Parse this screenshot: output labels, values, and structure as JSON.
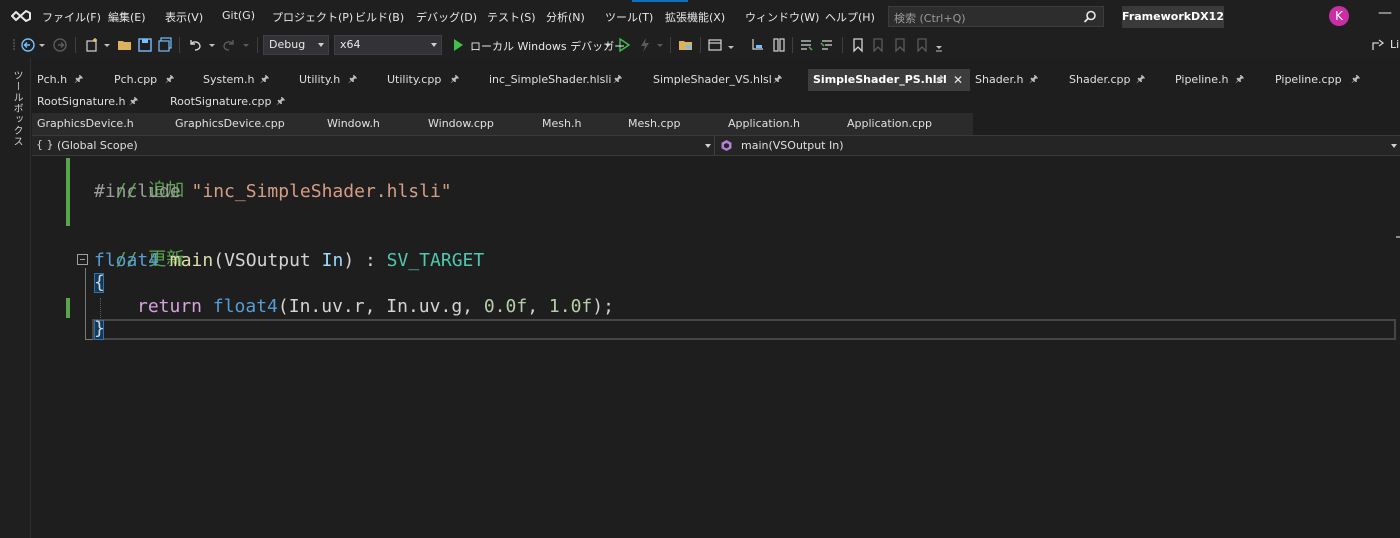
{
  "menu": [
    "ファイル(F)",
    "編集(E)",
    "表示(V)",
    "Git(G)",
    "プロジェクト(P)",
    "ビルド(B)",
    "デバッグ(D)",
    "テスト(S)",
    "分析(N)",
    "ツール(T)",
    "拡張機能(X)",
    "ウィンドウ(W)",
    "ヘルプ(H)"
  ],
  "search": {
    "placeholder": "検索 (Ctrl+Q)"
  },
  "project_name": "FrameworkDX12",
  "user_initial": "K",
  "window_controls": {
    "minimize": "—"
  },
  "toolbar": {
    "configuration": "Debug",
    "platform": "x64",
    "debugger_label": "ローカル Windows デバッガー",
    "live_share": "Li"
  },
  "toolbox_label": "ツールボックス",
  "tabs_row1": [
    {
      "label": "Pch.h",
      "active": false
    },
    {
      "label": "Pch.cpp",
      "active": false
    },
    {
      "label": "System.h",
      "active": false
    },
    {
      "label": "Utility.h",
      "active": false
    },
    {
      "label": "Utility.cpp",
      "active": false
    },
    {
      "label": "inc_SimpleShader.hlsli",
      "active": false
    },
    {
      "label": "SimpleShader_VS.hlsl",
      "active": false
    },
    {
      "label": "SimpleShader_PS.hlsl",
      "active": true
    },
    {
      "label": "Shader.h",
      "active": false
    },
    {
      "label": "Shader.cpp",
      "active": false
    },
    {
      "label": "Pipeline.h",
      "active": false
    },
    {
      "label": "Pipeline.cpp",
      "active": false
    }
  ],
  "tabs_row2": [
    {
      "label": "RootSignature.h"
    },
    {
      "label": "RootSignature.cpp"
    }
  ],
  "tabs_row3": [
    {
      "label": "GraphicsDevice.h"
    },
    {
      "label": "GraphicsDevice.cpp"
    },
    {
      "label": "Window.h"
    },
    {
      "label": "Window.cpp"
    },
    {
      "label": "Mesh.h"
    },
    {
      "label": "Mesh.cpp"
    },
    {
      "label": "Application.h"
    },
    {
      "label": "Application.cpp"
    }
  ],
  "navbar": {
    "scope_icon": "{ }",
    "scope": "(Global Scope)",
    "function": "main(VSOutput In)"
  },
  "code": {
    "comment1": "// 追加",
    "include_directive": "#include",
    "include_path": "\"inc_SimpleShader.hlsli\"",
    "comment2": "// 更新",
    "ret_type": "float4",
    "func_name": "main",
    "open_paren": "(",
    "param_type": "VSOutput",
    "param_name": "In",
    "close_paren_colon": ") : ",
    "semantic": "SV_TARGET",
    "open_brace": "{",
    "return_kw": "return",
    "ctor": "float4",
    "args_open": "(",
    "arg1": "In.uv.r",
    "comma1": ", ",
    "arg2": "In.uv.g",
    "comma2": ", ",
    "arg3": "0.0f",
    "comma3": ", ",
    "arg4": "1.0f",
    "args_close": ");",
    "close_brace": "}"
  }
}
